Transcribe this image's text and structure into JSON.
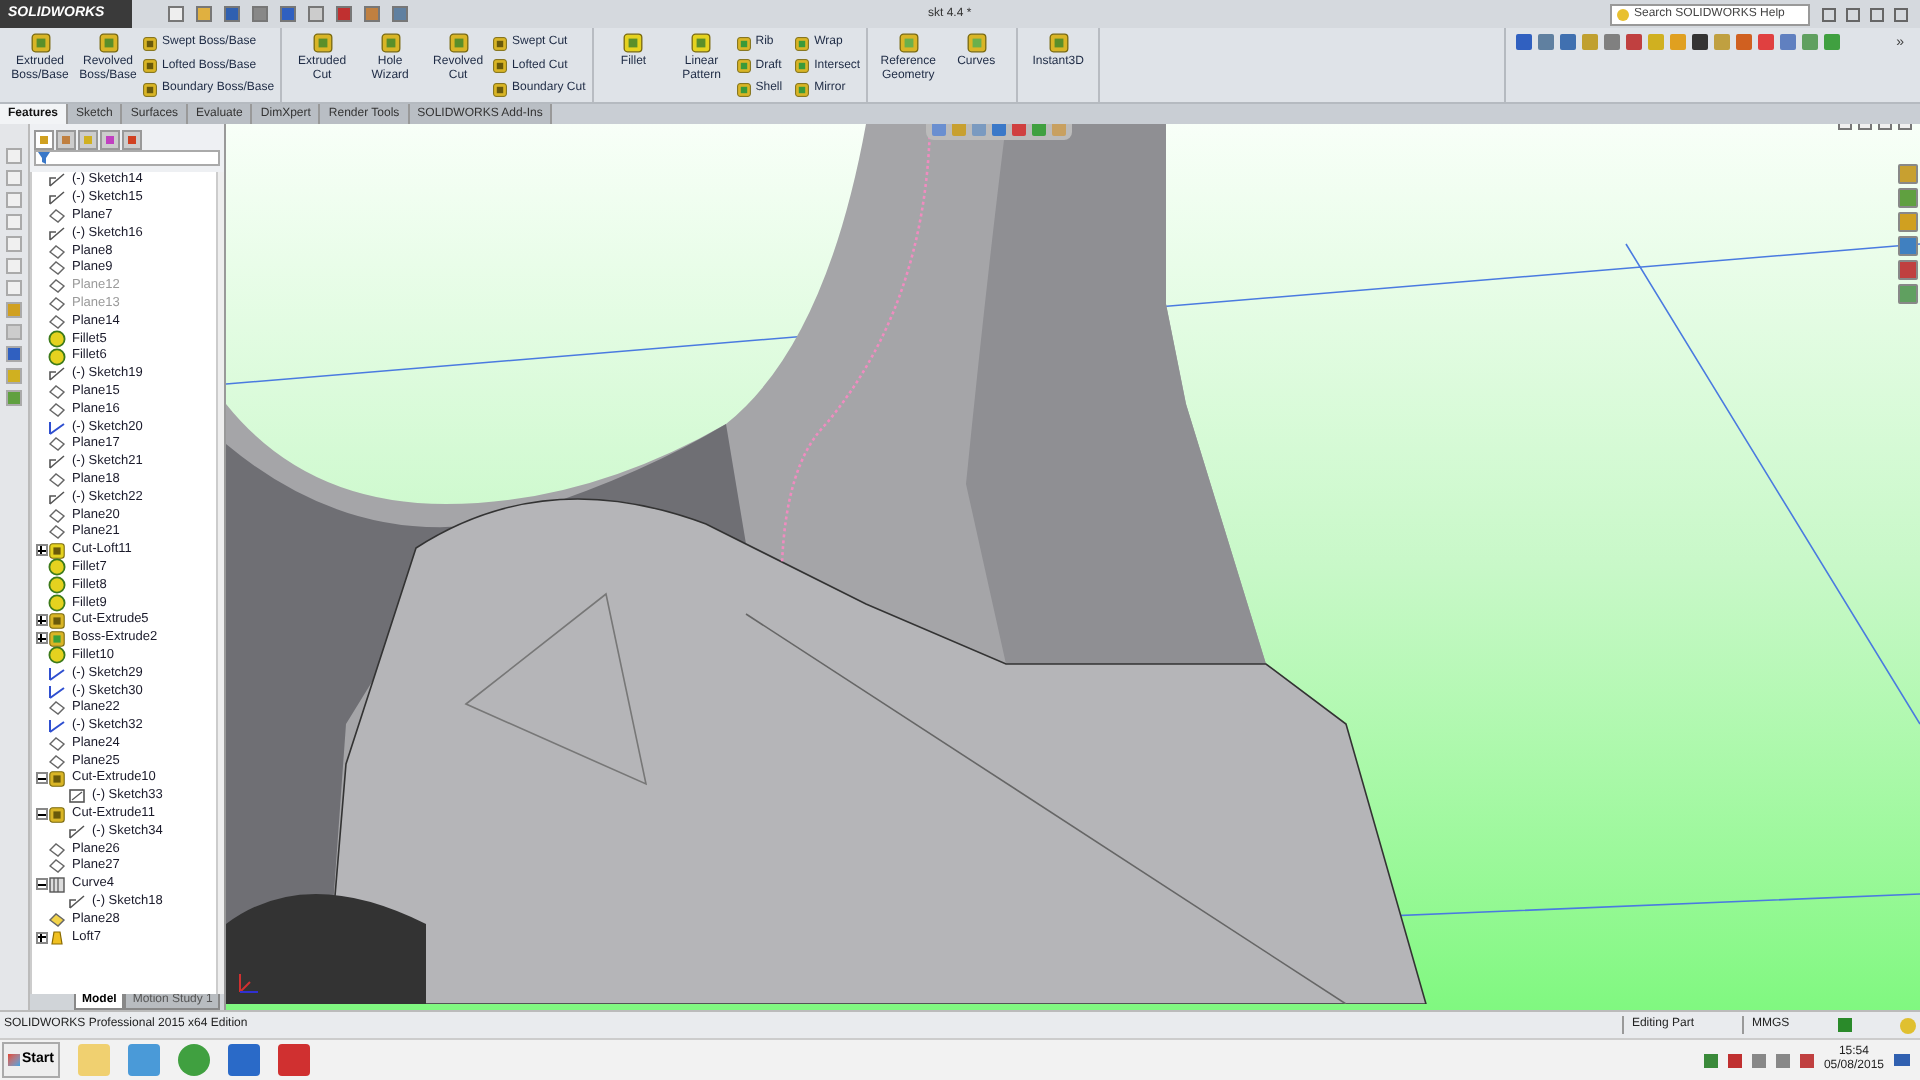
{
  "app": {
    "brand": "SOLIDWORKS",
    "document_title": "skt 4.4 *",
    "search": {
      "placeholder": "Search SOLIDWORKS Help"
    }
  },
  "ribbon": {
    "groups": [
      {
        "large": [
          "Extruded Boss/Base",
          "Revolved Boss/Base"
        ],
        "small": [
          "Swept Boss/Base",
          "Lofted Boss/Base",
          "Boundary Boss/Base"
        ]
      },
      {
        "large": [
          "Extruded Cut",
          "Hole Wizard",
          "Revolved Cut"
        ],
        "small": [
          "Swept Cut",
          "Lofted Cut",
          "Boundary Cut"
        ]
      },
      {
        "large": [
          "Fillet",
          "Linear Pattern"
        ],
        "small": [
          "Rib",
          "Draft",
          "Shell",
          "Wrap",
          "Intersect",
          "Mirror"
        ]
      },
      {
        "large": [
          "Reference Geometry",
          "Curves"
        ]
      },
      {
        "large": [
          "Instant3D"
        ]
      }
    ]
  },
  "overflow": "»",
  "tabs": [
    {
      "label": "Features",
      "selected": true
    },
    {
      "label": "Sketch",
      "selected": false
    },
    {
      "label": "Surfaces",
      "selected": false
    },
    {
      "label": "Evaluate",
      "selected": false
    },
    {
      "label": "DimXpert",
      "selected": false
    },
    {
      "label": "Render Tools",
      "selected": false
    },
    {
      "label": "SOLIDWORKS Add-Ins",
      "selected": false
    }
  ],
  "tree": {
    "items": [
      {
        "kind": "sketch",
        "label": "(-) Sketch14"
      },
      {
        "kind": "sketch",
        "label": "(-) Sketch15"
      },
      {
        "kind": "plane",
        "label": "Plane7",
        "disabled": false
      },
      {
        "kind": "sketch",
        "label": "(-) Sketch16"
      },
      {
        "kind": "plane",
        "label": "Plane8",
        "disabled": false
      },
      {
        "kind": "plane",
        "label": "Plane9",
        "disabled": false
      },
      {
        "kind": "plane",
        "label": "Plane12",
        "disabled": true
      },
      {
        "kind": "plane",
        "label": "Plane13",
        "disabled": true
      },
      {
        "kind": "plane",
        "label": "Plane14",
        "disabled": false
      },
      {
        "kind": "fillet",
        "label": "Fillet5"
      },
      {
        "kind": "fillet",
        "label": "Fillet6"
      },
      {
        "kind": "sketch",
        "label": "(-) Sketch19"
      },
      {
        "kind": "plane",
        "label": "Plane15",
        "disabled": false
      },
      {
        "kind": "plane",
        "label": "Plane16",
        "disabled": false
      },
      {
        "kind": "sketch3d",
        "label": "(-) Sketch20"
      },
      {
        "kind": "plane",
        "label": "Plane17",
        "disabled": false
      },
      {
        "kind": "sketch",
        "label": "(-) Sketch21"
      },
      {
        "kind": "plane",
        "label": "Plane18",
        "disabled": false
      },
      {
        "kind": "sketch",
        "label": "(-) Sketch22"
      },
      {
        "kind": "plane",
        "label": "Plane20",
        "disabled": false
      },
      {
        "kind": "plane",
        "label": "Plane21",
        "disabled": false
      },
      {
        "kind": "loftcut",
        "label": "Cut-Loft11",
        "expanded": false
      },
      {
        "kind": "fillet",
        "label": "Fillet7"
      },
      {
        "kind": "fillet",
        "label": "Fillet8"
      },
      {
        "kind": "fillet",
        "label": "Fillet9"
      },
      {
        "kind": "cut",
        "label": "Cut-Extrude5",
        "expanded": false
      },
      {
        "kind": "boss",
        "label": "Boss-Extrude2",
        "expanded": false
      },
      {
        "kind": "fillet",
        "label": "Fillet10"
      },
      {
        "kind": "sketch3d",
        "label": "(-) Sketch29"
      },
      {
        "kind": "sketch3d",
        "label": "(-) Sketch30"
      },
      {
        "kind": "plane",
        "label": "Plane22",
        "disabled": false
      },
      {
        "kind": "sketch3d",
        "label": "(-) Sketch32"
      },
      {
        "kind": "plane",
        "label": "Plane24",
        "disabled": false
      },
      {
        "kind": "plane",
        "label": "Plane25",
        "disabled": false
      },
      {
        "kind": "cut",
        "label": "Cut-Extrude10",
        "expanded": true,
        "children": [
          {
            "kind": "sketchbox",
            "label": "(-) Sketch33"
          }
        ]
      },
      {
        "kind": "cut",
        "label": "Cut-Extrude11",
        "expanded": true,
        "children": [
          {
            "kind": "sketch",
            "label": "(-) Sketch34"
          }
        ]
      },
      {
        "kind": "plane",
        "label": "Plane26",
        "disabled": false
      },
      {
        "kind": "plane",
        "label": "Plane27",
        "disabled": false
      },
      {
        "kind": "curve",
        "label": "Curve4",
        "expanded": true,
        "children": [
          {
            "kind": "sketch",
            "label": "(-) Sketch18"
          }
        ]
      },
      {
        "kind": "planeyellow",
        "label": "Plane28",
        "disabled": false
      },
      {
        "kind": "loft",
        "label": "Loft7",
        "expanded": false
      }
    ]
  },
  "bottom_tabs": [
    {
      "label": "Model",
      "selected": true
    },
    {
      "label": "Motion Study 1",
      "selected": false
    }
  ],
  "status_bar": {
    "product": "SOLIDWORKS Professional 2015 x64 Edition",
    "mode": "Editing Part",
    "units": "MMGS"
  },
  "taskbar": {
    "start": "Start",
    "time": "15:54",
    "date": "05/08/2015"
  }
}
